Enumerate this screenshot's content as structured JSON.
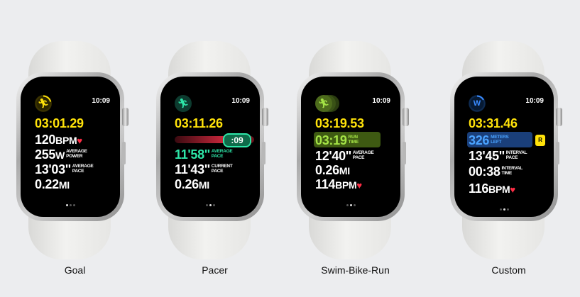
{
  "watches": [
    {
      "caption": "Goal",
      "time": "10:09",
      "icon": "running-figure-icon",
      "icon_color": "#ffe20a",
      "elapsed": "03:01.29",
      "heart_rate": {
        "value": "120",
        "unit": "BPM"
      },
      "power": {
        "value": "255",
        "unit": "W",
        "label_1": "AVERAGE",
        "label_2": "POWER"
      },
      "pace": {
        "value": "13'03''",
        "label_1": "AVERAGE",
        "label_2": "PACE"
      },
      "distance": {
        "value": "0.22",
        "unit": "MI"
      }
    },
    {
      "caption": "Pacer",
      "time": "10:09",
      "icon": "running-figure-icon",
      "icon_color": "#2ee6a8",
      "elapsed": "03:11.26",
      "pacer_badge": ":09",
      "avg_pace": {
        "value": "11'58''",
        "label_1": "AVERAGE",
        "label_2": "PACE"
      },
      "current_pace": {
        "value": "11'43''",
        "label_1": "CURRENT",
        "label_2": "PACE"
      },
      "distance": {
        "value": "0.26",
        "unit": "MI"
      }
    },
    {
      "caption": "Swim-Bike-Run",
      "time": "10:09",
      "icon": "running-figure-icon",
      "icon_color": "#a4e346",
      "elapsed": "03:19.53",
      "run_time": {
        "value": "03:19",
        "label_1": "RUN",
        "label_2": "TIME"
      },
      "avg_pace": {
        "value": "12'40''",
        "label_1": "AVERAGE",
        "label_2": "PACE"
      },
      "distance": {
        "value": "0.26",
        "unit": "MI"
      },
      "heart_rate": {
        "value": "114",
        "unit": "BPM"
      }
    },
    {
      "caption": "Custom",
      "time": "10:09",
      "icon_letter": "W",
      "icon_color": "#3a8bff",
      "elapsed": "03:31.46",
      "meters_left": {
        "value": "326",
        "label_1": "METERS",
        "label_2": "LEFT"
      },
      "r_badge": "R",
      "interval_pace": {
        "value": "13'45''",
        "label_1": "INTERVAL",
        "label_2": "PACE"
      },
      "interval_time": {
        "value": "00:38",
        "label_1": "INTERVAL",
        "label_2": "TIME"
      },
      "heart_rate": {
        "value": "116",
        "unit": "BPM"
      }
    }
  ]
}
